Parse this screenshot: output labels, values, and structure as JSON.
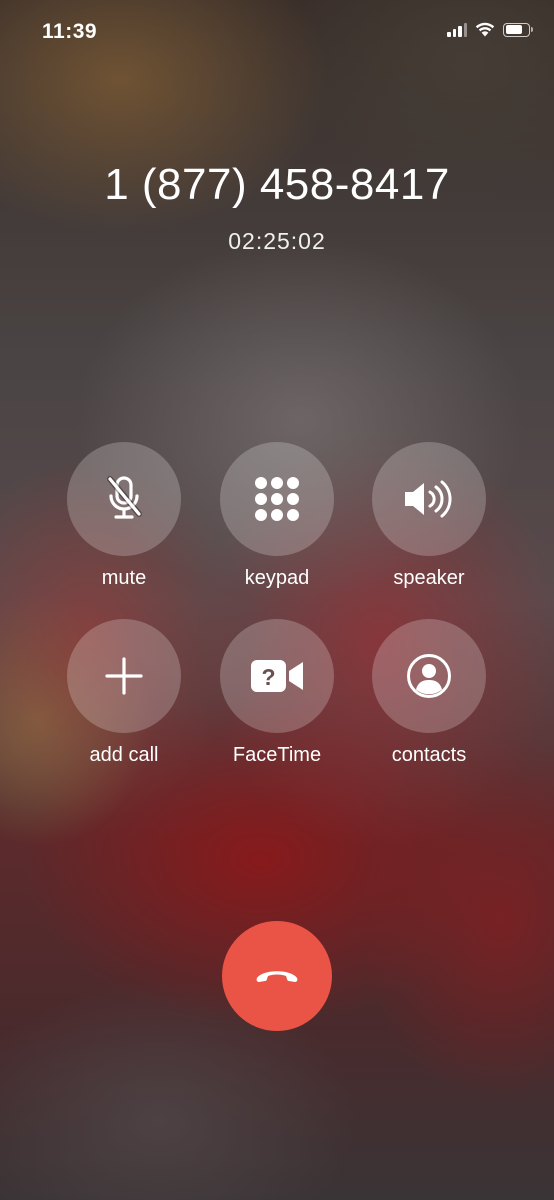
{
  "status_bar": {
    "time": "11:39",
    "signal_bars_filled": 3,
    "signal_bars_total": 4,
    "wifi_icon": "wifi-icon",
    "battery_level": 0.75
  },
  "call": {
    "number": "1 (877) 458-8417",
    "duration": "02:25:02"
  },
  "controls": [
    {
      "id": "mute",
      "label": "mute",
      "icon": "microphone-slash-icon"
    },
    {
      "id": "keypad",
      "label": "keypad",
      "icon": "keypad-icon"
    },
    {
      "id": "speaker",
      "label": "speaker",
      "icon": "speaker-icon"
    },
    {
      "id": "add-call",
      "label": "add call",
      "icon": "plus-icon"
    },
    {
      "id": "facetime",
      "label": "FaceTime",
      "icon": "video-camera-question-icon"
    },
    {
      "id": "contacts",
      "label": "contacts",
      "icon": "person-circle-icon"
    }
  ],
  "end_call": {
    "icon": "phone-hangup-icon",
    "color": "#ea5446"
  }
}
